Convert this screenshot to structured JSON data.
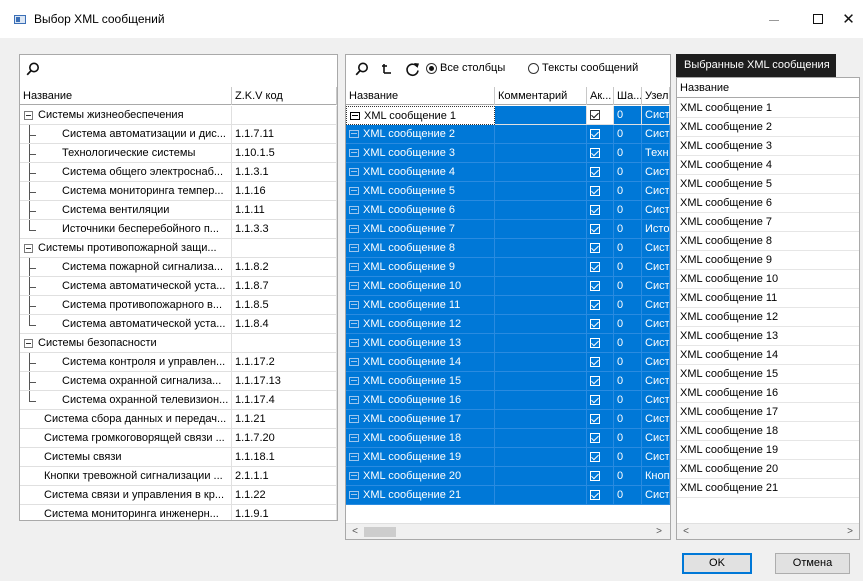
{
  "window": {
    "title": "Выбор XML сообщений",
    "minimize_icon": "minimize-icon",
    "maximize_icon": "maximize-icon",
    "close_icon": "close-icon",
    "close_glyph": "✕"
  },
  "left": {
    "search_icon": "search-icon",
    "columns": [
      "Название",
      "Z.K.V код"
    ],
    "rows": [
      {
        "name": "Системы жизнеобеспечения",
        "code": "",
        "level": 0,
        "expander": true
      },
      {
        "name": "Система автоматизации и дис...",
        "code": "1.1.7.11",
        "level": 1
      },
      {
        "name": "Технологические системы",
        "code": "1.10.1.5",
        "level": 1
      },
      {
        "name": "Система общего электроснаб...",
        "code": "1.1.3.1",
        "level": 1
      },
      {
        "name": "Система мониторинга темпер...",
        "code": "1.1.16",
        "level": 1
      },
      {
        "name": "Система вентиляции",
        "code": "1.1.11",
        "level": 1
      },
      {
        "name": "Источники бесперебойного п...",
        "code": "1.1.3.3",
        "level": 1,
        "last": true
      },
      {
        "name": "Системы противопожарной защи...",
        "code": "",
        "level": 0,
        "expander": true
      },
      {
        "name": "Система пожарной сигнализа...",
        "code": "1.1.8.2",
        "level": 1
      },
      {
        "name": "Система автоматической уста...",
        "code": "1.1.8.7",
        "level": 1
      },
      {
        "name": "Система противопожарного в...",
        "code": "1.1.8.5",
        "level": 1
      },
      {
        "name": "Система автоматической уста...",
        "code": "1.1.8.4",
        "level": 1,
        "last": true
      },
      {
        "name": "Системы безопасности",
        "code": "",
        "level": 0,
        "expander": true
      },
      {
        "name": "Система контроля и управлен...",
        "code": "1.1.17.2",
        "level": 1
      },
      {
        "name": "Система охранной сигнализа...",
        "code": "1.1.17.13",
        "level": 1
      },
      {
        "name": "Система охранной телевизион...",
        "code": "1.1.17.4",
        "level": 1,
        "last": true
      },
      {
        "name": "Система сбора данных и передач...",
        "code": "1.1.21",
        "level": 0
      },
      {
        "name": "Система громкоговорящей связи ...",
        "code": "1.1.7.20",
        "level": 0
      },
      {
        "name": "Системы связи",
        "code": "1.1.18.1",
        "level": 0
      },
      {
        "name": "Кнопки тревожной сигнализации ...",
        "code": "2.1.1.1",
        "level": 0
      },
      {
        "name": "Система связи и управления в кр...",
        "code": "1.1.22",
        "level": 0
      },
      {
        "name": "Система мониторинга инженерн...",
        "code": "1.1.9.1",
        "level": 0
      }
    ]
  },
  "middle": {
    "search_icon": "search-icon",
    "tree_icon": "tree-toggle-icon",
    "refresh_icon": "refresh-icon",
    "radio_all": "Все столбцы",
    "radio_texts": "Тексты сообщений",
    "radio_selected": "all",
    "columns": [
      "Название",
      "Комментарий",
      "Ак...",
      "Ша...",
      "Узел"
    ],
    "rows": [
      {
        "name": "XML сообщение 1",
        "comment": "",
        "active": true,
        "step": "0",
        "node": "Сист",
        "selected": false
      },
      {
        "name": "XML сообщение 2",
        "comment": "",
        "active": true,
        "step": "0",
        "node": "Сист",
        "selected": true
      },
      {
        "name": "XML сообщение 3",
        "comment": "",
        "active": true,
        "step": "0",
        "node": "Техн",
        "selected": true
      },
      {
        "name": "XML сообщение 4",
        "comment": "",
        "active": true,
        "step": "0",
        "node": "Сист",
        "selected": true
      },
      {
        "name": "XML сообщение 5",
        "comment": "",
        "active": true,
        "step": "0",
        "node": "Сист",
        "selected": true
      },
      {
        "name": "XML сообщение 6",
        "comment": "",
        "active": true,
        "step": "0",
        "node": "Сист",
        "selected": true
      },
      {
        "name": "XML сообщение 7",
        "comment": "",
        "active": true,
        "step": "0",
        "node": "Исто",
        "selected": true
      },
      {
        "name": "XML сообщение 8",
        "comment": "",
        "active": true,
        "step": "0",
        "node": "Сист",
        "selected": true
      },
      {
        "name": "XML сообщение 9",
        "comment": "",
        "active": true,
        "step": "0",
        "node": "Сист",
        "selected": true
      },
      {
        "name": "XML сообщение 10",
        "comment": "",
        "active": true,
        "step": "0",
        "node": "Сист",
        "selected": true
      },
      {
        "name": "XML сообщение 11",
        "comment": "",
        "active": true,
        "step": "0",
        "node": "Сист",
        "selected": true
      },
      {
        "name": "XML сообщение 12",
        "comment": "",
        "active": true,
        "step": "0",
        "node": "Сист",
        "selected": true
      },
      {
        "name": "XML сообщение 13",
        "comment": "",
        "active": true,
        "step": "0",
        "node": "Сист",
        "selected": true
      },
      {
        "name": "XML сообщение 14",
        "comment": "",
        "active": true,
        "step": "0",
        "node": "Сист",
        "selected": true
      },
      {
        "name": "XML сообщение 15",
        "comment": "",
        "active": true,
        "step": "0",
        "node": "Сист",
        "selected": true
      },
      {
        "name": "XML сообщение 16",
        "comment": "",
        "active": true,
        "step": "0",
        "node": "Сист",
        "selected": true
      },
      {
        "name": "XML сообщение 17",
        "comment": "",
        "active": true,
        "step": "0",
        "node": "Сист",
        "selected": true
      },
      {
        "name": "XML сообщение 18",
        "comment": "",
        "active": true,
        "step": "0",
        "node": "Сист",
        "selected": true
      },
      {
        "name": "XML сообщение 19",
        "comment": "",
        "active": true,
        "step": "0",
        "node": "Сист",
        "selected": true
      },
      {
        "name": "XML сообщение 20",
        "comment": "",
        "active": true,
        "step": "0",
        "node": "Кноп",
        "selected": true
      },
      {
        "name": "XML сообщение 21",
        "comment": "",
        "active": true,
        "step": "0",
        "node": "Сист",
        "selected": true
      }
    ],
    "scroll_left": "<",
    "scroll_right": ">"
  },
  "right": {
    "title": "Выбранные XML сообщения",
    "column": "Название",
    "items": [
      "XML сообщение 1",
      "XML сообщение 2",
      "XML сообщение 3",
      "XML сообщение 4",
      "XML сообщение 5",
      "XML сообщение 6",
      "XML сообщение 7",
      "XML сообщение 8",
      "XML сообщение 9",
      "XML сообщение 10",
      "XML сообщение 11",
      "XML сообщение 12",
      "XML сообщение 13",
      "XML сообщение 14",
      "XML сообщение 15",
      "XML сообщение 16",
      "XML сообщение 17",
      "XML сообщение 18",
      "XML сообщение 19",
      "XML сообщение 20",
      "XML сообщение 21"
    ],
    "scroll_left": "<",
    "scroll_right": ">"
  },
  "footer": {
    "ok_label": "OK",
    "cancel_label": "Отмена"
  },
  "colors": {
    "selection": "#0078d7",
    "header_dark": "#1e1e1e"
  }
}
